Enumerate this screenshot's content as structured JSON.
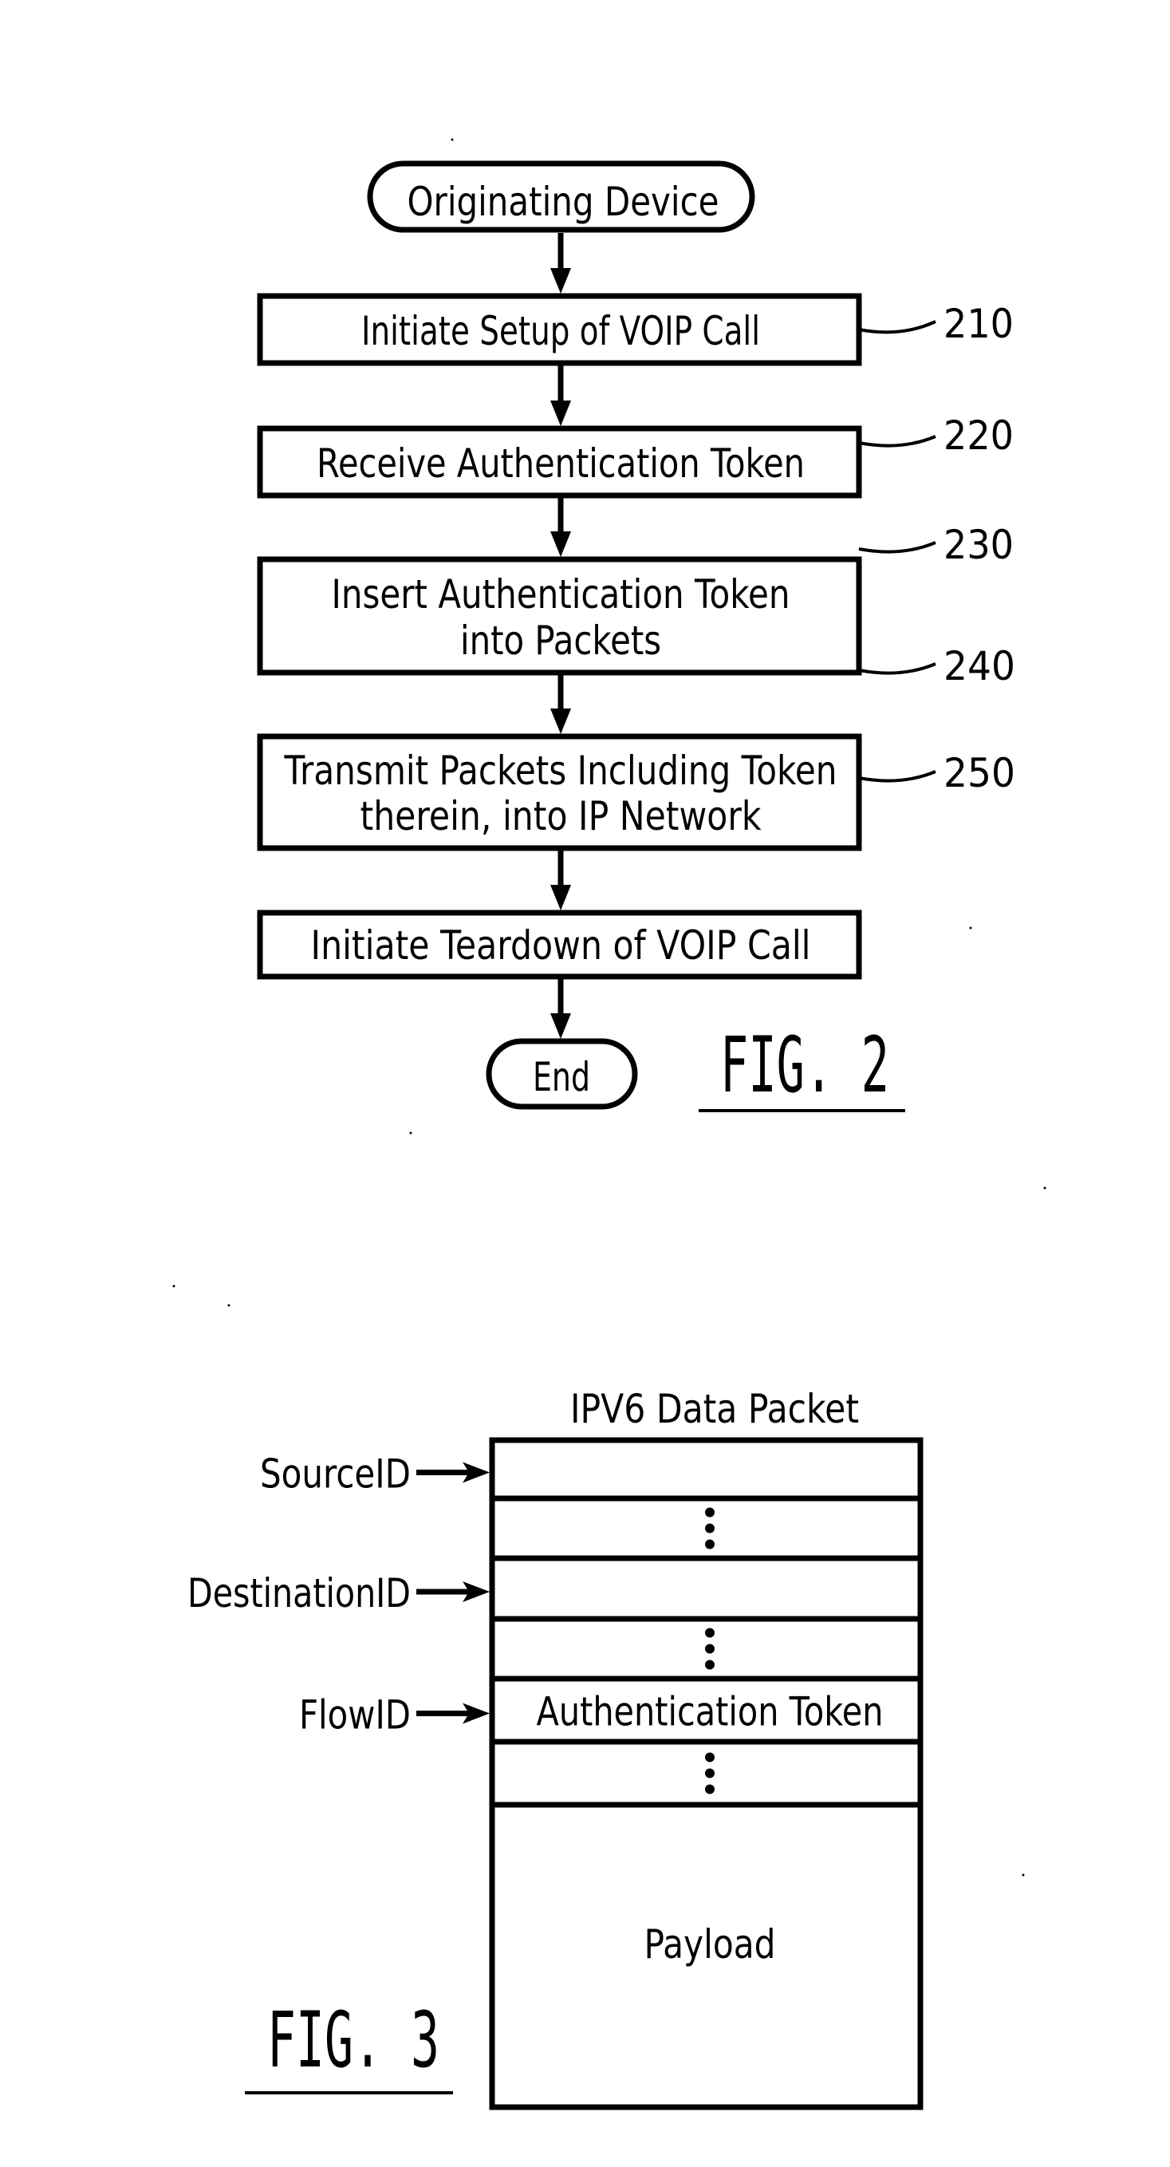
{
  "fig2": {
    "caption": "FIG. 2",
    "start_terminal": "Originating Device",
    "end_terminal": "End",
    "steps": [
      {
        "ref": "210",
        "lines": [
          "Initiate Setup of VOIP Call"
        ]
      },
      {
        "ref": "220",
        "lines": [
          "Receive Authentication Token"
        ]
      },
      {
        "ref": "230",
        "lines": [
          "Insert Authentication Token",
          "into Packets"
        ]
      },
      {
        "ref": "240",
        "lines": [
          "Transmit Packets Including Token",
          "therein, into IP Network"
        ]
      },
      {
        "ref": "250",
        "lines": [
          "Initiate Teardown of VOIP Call"
        ]
      }
    ]
  },
  "fig3": {
    "caption": "FIG. 3",
    "title": "IPV6 Data Packet",
    "fields": [
      {
        "pointer_label": "SourceID",
        "content": "",
        "ellipsis": false
      },
      {
        "pointer_label": "",
        "content": "",
        "ellipsis": true
      },
      {
        "pointer_label": "DestinationID",
        "content": "",
        "ellipsis": false
      },
      {
        "pointer_label": "",
        "content": "",
        "ellipsis": true
      },
      {
        "pointer_label": "FlowID",
        "content": "Authentication Token",
        "ellipsis": false
      },
      {
        "pointer_label": "",
        "content": "",
        "ellipsis": true
      },
      {
        "pointer_label": "",
        "content": "Payload",
        "ellipsis": false
      }
    ]
  },
  "colors": {
    "ink": "#000000",
    "paper": "#ffffff"
  }
}
